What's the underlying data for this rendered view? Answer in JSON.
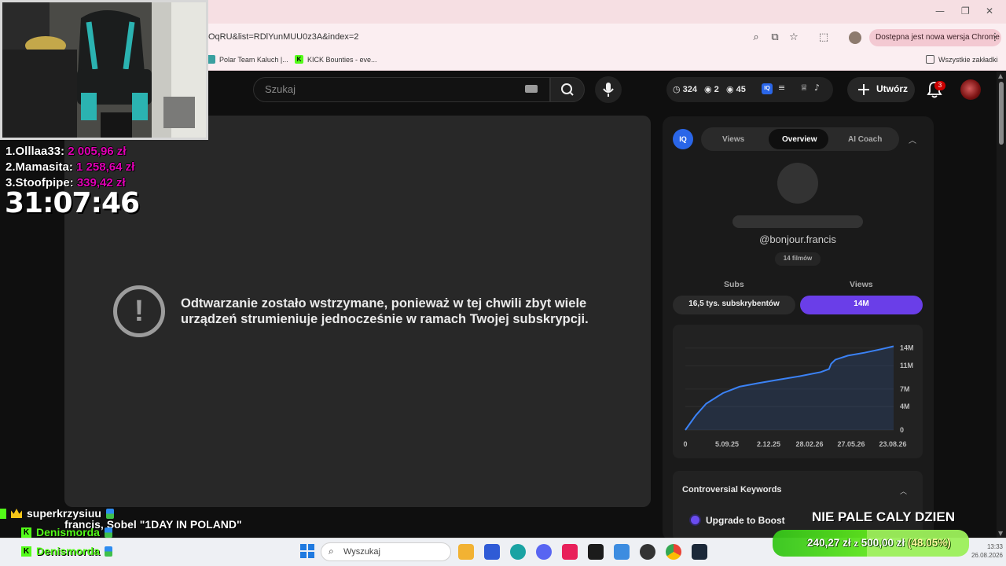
{
  "browser": {
    "url": "OqRU&list=RDlYunMUU0z3A&index=2",
    "update_text": "Dostępna jest nowa wersja Chrome",
    "bookmarks": [
      {
        "label": "Polar Team Kaluch |..."
      },
      {
        "label": "KICK Bounties - eve..."
      }
    ],
    "all_bookmarks": "Wszystkie zakładki"
  },
  "header": {
    "search_placeholder": "Szukaj",
    "stats": {
      "likes": "324",
      "watching": "2",
      "views": "45"
    },
    "create_label": "Utwórz",
    "notifications_count": "3"
  },
  "player": {
    "error_line1": "Odtwarzanie zostało wstrzymane, ponieważ w tej chwili zbyt wiele",
    "error_line2": "urządzeń strumieniuje jednocześnie w ramach Twojej subskrypcji."
  },
  "side_panel": {
    "logo": "IQ",
    "tabs": [
      "Views",
      "Overview",
      "AI Coach"
    ],
    "active_tab": "Overview",
    "handle": "@bonjour.francis",
    "films": "14 filmów",
    "subs_label": "Subs",
    "views_label": "Views",
    "subs_value": "16,5 tys. subskrybentów",
    "views_value": "14M",
    "keywords_title": "Controversial Keywords",
    "boost_label": "Upgrade to Boost"
  },
  "chart_data": {
    "type": "area",
    "x_ticks": [
      "0",
      "5.09.25",
      "2.12.25",
      "28.02.26",
      "27.05.26",
      "23.08.26"
    ],
    "y_ticks": [
      "0",
      "4M",
      "7M",
      "11M",
      "14M"
    ],
    "ylim": [
      0,
      14.5
    ],
    "series": [
      {
        "x": [
          0,
          0.05,
          0.1,
          0.18,
          0.26,
          0.35,
          0.45,
          0.55,
          0.65,
          0.69,
          0.7,
          0.72,
          0.78,
          0.86,
          0.94,
          1.0
        ],
        "values": [
          0.0,
          2.5,
          4.5,
          6.3,
          7.4,
          8.0,
          8.6,
          9.2,
          9.9,
          10.4,
          11.3,
          12.0,
          12.7,
          13.2,
          13.8,
          14.3
        ]
      }
    ],
    "color": "#3b82f6"
  },
  "overlay": {
    "leaderboard": [
      {
        "rank": "1.",
        "name": "Olllaa33:",
        "amount": "2 005,96 zł"
      },
      {
        "rank": "2.",
        "name": "Mamasita:",
        "amount": "1 258,64 zł"
      },
      {
        "rank": "3.",
        "name": "Stoofpipe:",
        "amount": "339,42 zł"
      }
    ],
    "timer": "31:07:46",
    "chat": [
      {
        "user": "superkrzysiuu",
        "color": "#ffffff"
      },
      {
        "user": "Denismorda",
        "color": "#53fc18"
      },
      {
        "user": "Denismorda",
        "color": "#53fc18"
      }
    ],
    "chat_message": "francis, Sobel \"1DAY IN POLAND\"",
    "banner": "NIE PALE CALY DZIEN",
    "goal_current": "240,27 zł",
    "goal_sep": "z",
    "goal_target": "500,00 zł",
    "goal_pct": "(48.05%)",
    "goal_fraction": 0.4805
  },
  "taskbar": {
    "search_label": "Wyszukaj",
    "time": "13:33",
    "date": "26.08.2026"
  }
}
